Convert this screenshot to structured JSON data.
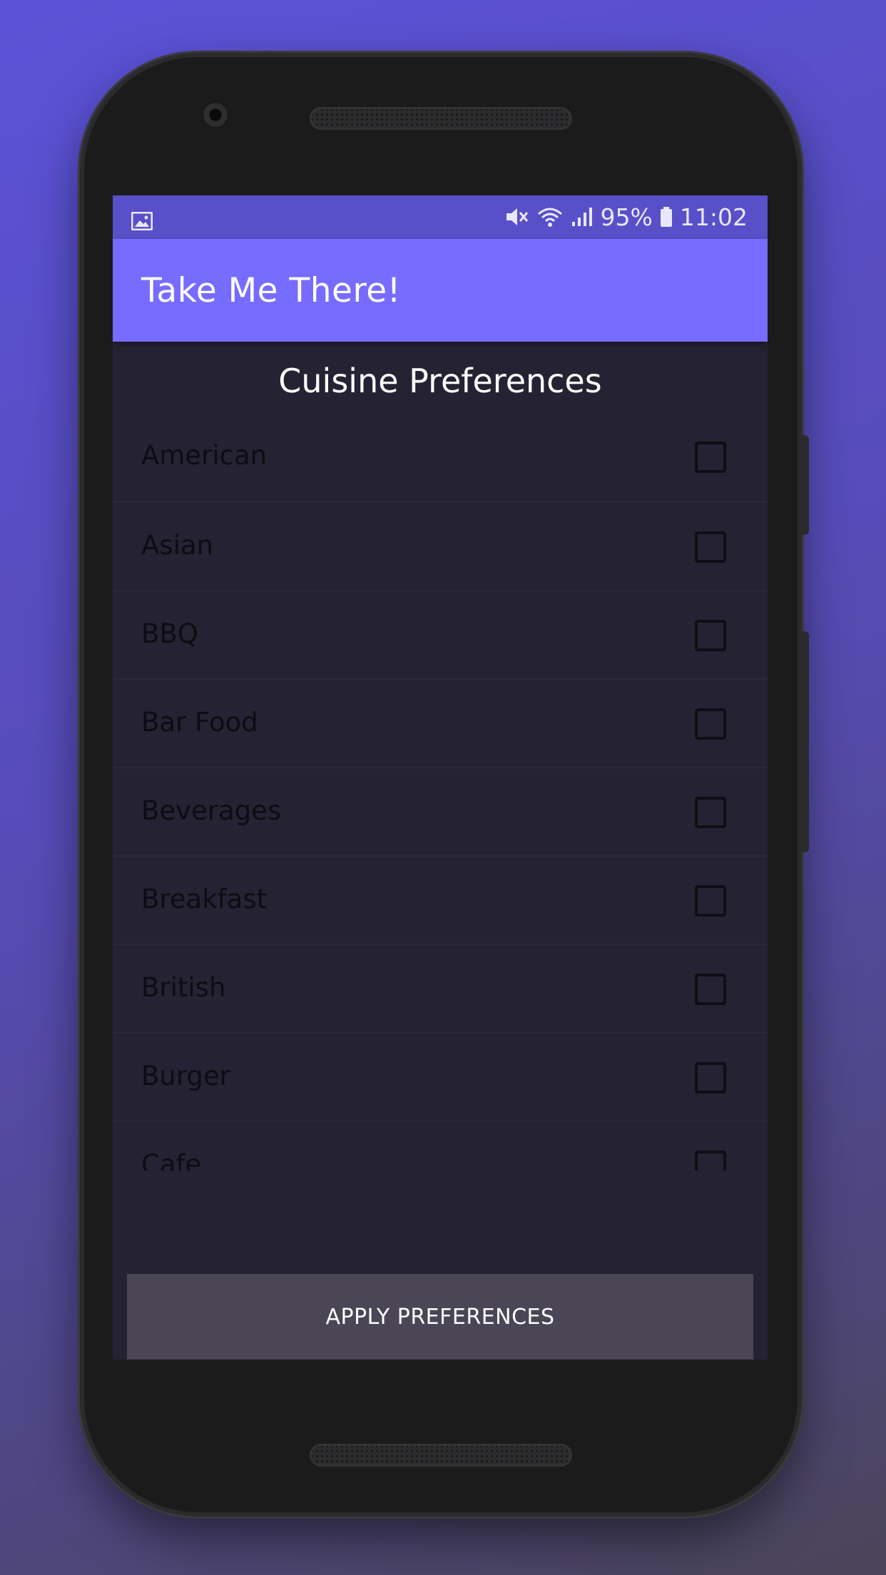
{
  "status_bar": {
    "battery_percent": "95%",
    "time": "11:02",
    "icons": [
      "image-icon",
      "mute-icon",
      "wifi-icon",
      "signal-icon",
      "battery-icon"
    ]
  },
  "app_bar": {
    "title": "Take Me There!"
  },
  "main": {
    "heading": "Cuisine Preferences",
    "items": [
      {
        "label": "American",
        "checked": false
      },
      {
        "label": "Asian",
        "checked": false
      },
      {
        "label": "BBQ",
        "checked": false
      },
      {
        "label": "Bar Food",
        "checked": false
      },
      {
        "label": "Beverages",
        "checked": false
      },
      {
        "label": "Breakfast",
        "checked": false
      },
      {
        "label": "British",
        "checked": false
      },
      {
        "label": "Burger",
        "checked": false
      },
      {
        "label": "Cafe",
        "checked": false
      }
    ],
    "apply_label": "APPLY PREFERENCES"
  },
  "colors": {
    "background_gradient_start": "#5b52d8",
    "status_bar": "#5750c8",
    "app_bar": "#766cff",
    "screen_bg": "#252233",
    "button_bg": "#4a4656"
  }
}
